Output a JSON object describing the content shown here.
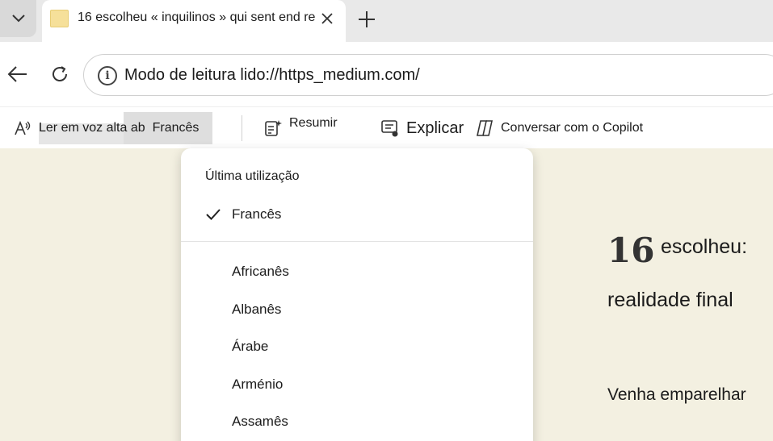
{
  "tab": {
    "title": "16 escolheu « inquilinos » qui sent end re"
  },
  "addressbar": {
    "url": "Modo de leitura lido://https_medium.com/"
  },
  "reader_toolbar": {
    "read_aloud": "Ler em voz alta ab",
    "language": "Francês",
    "summarize": "Resumir",
    "explain": "Explicar",
    "copilot": "Conversar com o Copilot"
  },
  "language_menu": {
    "section_label": "Última utilização",
    "selected": "Francês",
    "items": [
      "Africanês",
      "Albanês",
      "Árabe",
      "Arménio",
      "Assamês"
    ]
  },
  "article": {
    "number": "16",
    "title_part1": "escolheu:",
    "title_part2": "realidade final",
    "subtitle": "Venha emparelhar"
  }
}
